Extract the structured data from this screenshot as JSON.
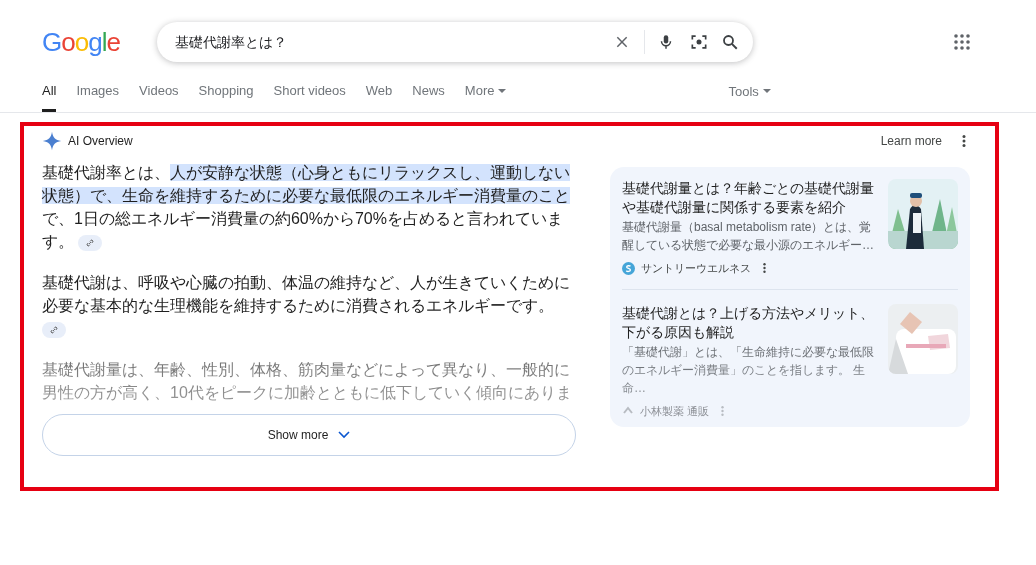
{
  "logo": "Google",
  "search": {
    "value": "基礎代謝率とは？"
  },
  "tabs": [
    {
      "label": "All",
      "selected": true
    },
    {
      "label": "Images",
      "selected": false
    },
    {
      "label": "Videos",
      "selected": false
    },
    {
      "label": "Shopping",
      "selected": false
    },
    {
      "label": "Short videos",
      "selected": false
    },
    {
      "label": "Web",
      "selected": false
    },
    {
      "label": "News",
      "selected": false
    },
    {
      "label": "More",
      "selected": false,
      "dropdown": true
    }
  ],
  "tools": "Tools",
  "ai_overview": {
    "title": "AI Overview",
    "learn_more": "Learn more",
    "paragraphs": [
      {
        "faded": false,
        "link": true,
        "segments": [
          {
            "text": "基礎代謝率とは、",
            "highlighted": false
          },
          {
            "text": "人が安静な状態（心身ともにリラックスし、運動しない状態）で、生命を維持するために必要な最低限のエネルギー消費量のこと",
            "highlighted": true
          },
          {
            "text": "で、1日の総エネルギー消費量の約60%から70%を占めると言われています。",
            "highlighted": false
          }
        ]
      },
      {
        "faded": false,
        "link": true,
        "segments": [
          {
            "text": "基礎代謝は、呼吸や心臓の拍動、体温の維持など、人が生きていくために必要な基本的な生理機能を維持するために消費されるエネルギーです。",
            "highlighted": false
          }
        ]
      },
      {
        "faded": true,
        "link": false,
        "segments": [
          {
            "text": "基礎代謝量は、年齢、性別、体格、筋肉量などによって異なり、一般的に男性の方が高く、10代をピークに加齢とともに低下していく傾向にありま",
            "highlighted": false
          }
        ]
      }
    ],
    "show_more": "Show more",
    "sources": [
      {
        "title": "基礎代謝量とは？年齢ごとの基礎代謝量や基礎代謝量に関係する要素を紹介",
        "snippet": "基礎代謝量（basal metabolism rate）とは、覚醒している状態で必要な最小源のエネルギー…",
        "site": "サントリーウエルネス",
        "faded": false
      },
      {
        "title": "基礎代謝とは？上げる方法やメリット、下がる原因も解説",
        "snippet": "「基礎代謝」とは、「生命維持に必要な最低限のエネルギー消費量」のことを指します。 生命…",
        "site": "小林製薬 通販",
        "faded": true
      }
    ]
  }
}
